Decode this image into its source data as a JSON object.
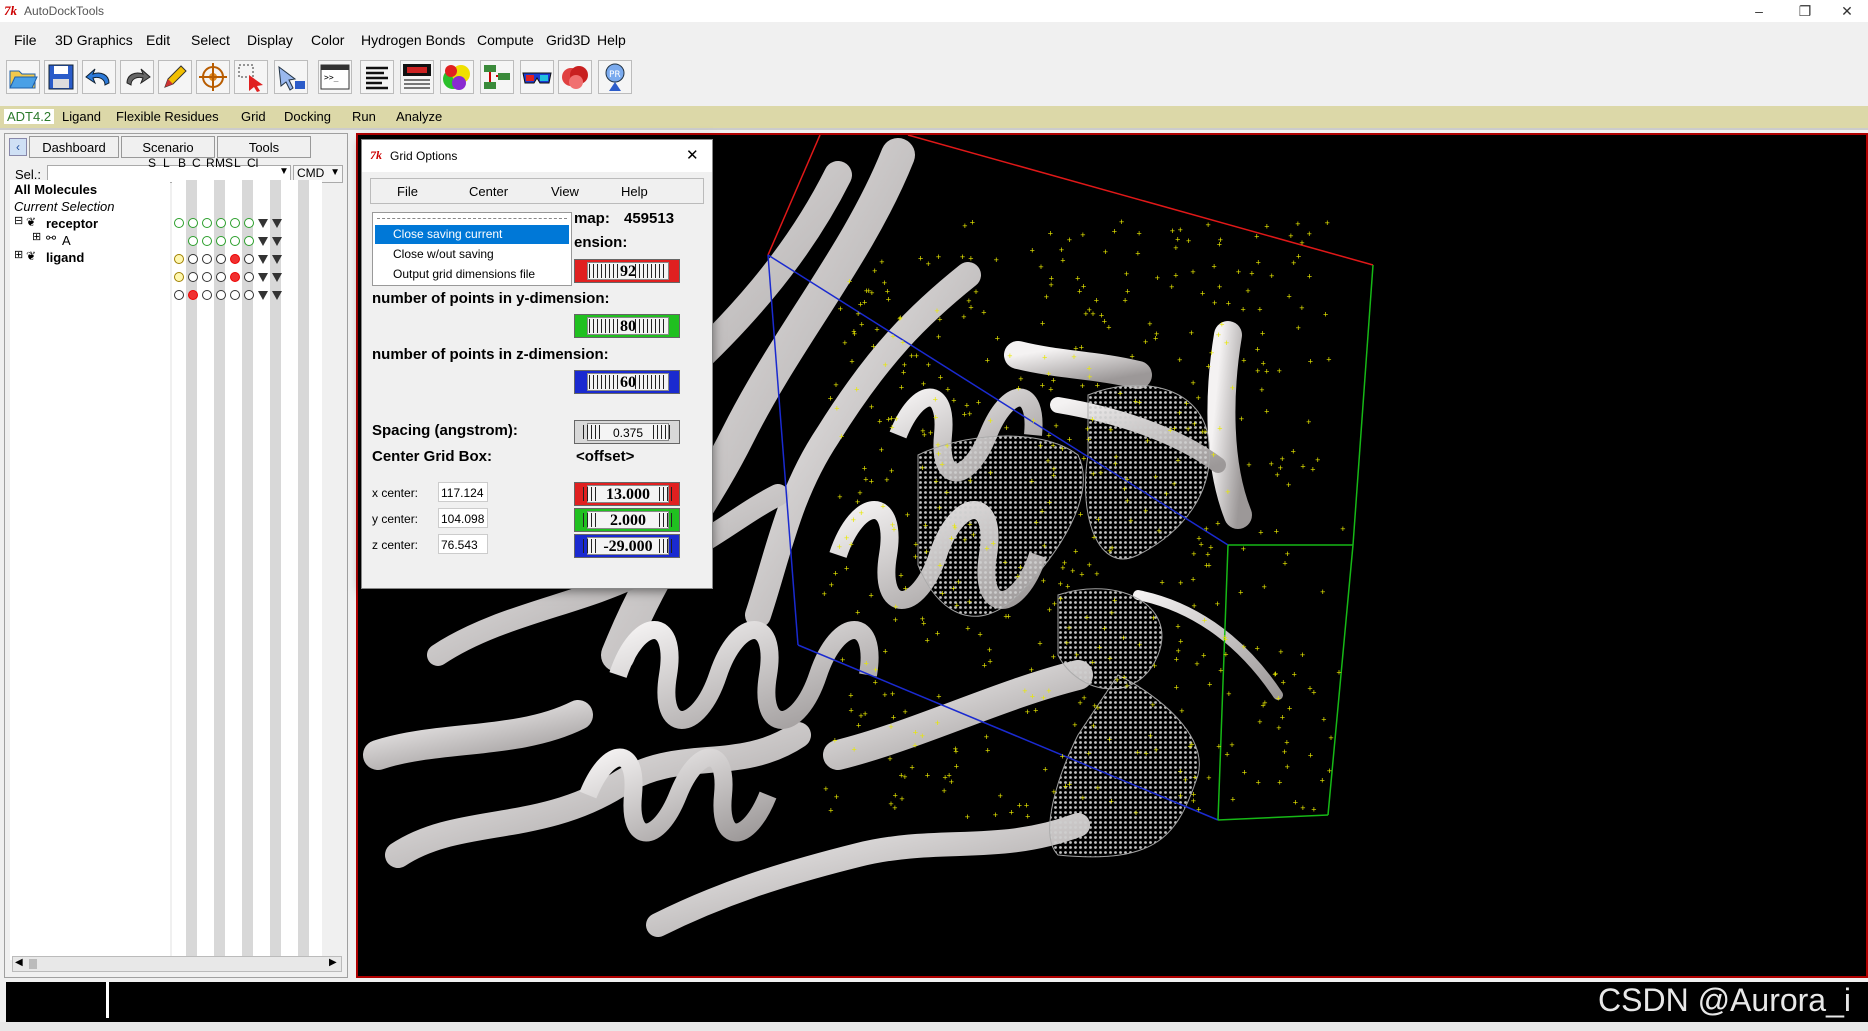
{
  "window": {
    "title": "AutoDockTools",
    "logo": "7k",
    "controls": [
      "–",
      "❐",
      "✕"
    ]
  },
  "menubar": [
    "File",
    "3D Graphics",
    "Edit",
    "Select",
    "Display",
    "Color",
    "Hydrogen Bonds",
    "Compute",
    "Grid3D",
    "Help"
  ],
  "toolbar_icons": [
    "open-folder-icon",
    "save-disk-icon",
    "undo-icon",
    "redo-icon",
    "pencil-icon",
    "center-target-icon",
    "select-icon",
    "pick-icon",
    "python-shell-icon",
    "lines-icon",
    "sequence-viewer-icon",
    "color-sphere-icon",
    "network-icon",
    "stereo-glasses-icon",
    "surface-icon",
    "info-icon"
  ],
  "adt_tabs": [
    "ADT4.2",
    "Ligand",
    "Flexible Residues",
    "Grid",
    "Docking",
    "Run",
    "Analyze"
  ],
  "dashboard": {
    "tabs": [
      "Dashboard",
      "Scenario",
      "Tools"
    ],
    "sel_label": "Sel.:",
    "cmd_label": "CMD",
    "column_headers": [
      "S",
      "L",
      "B",
      "C",
      "R",
      "MS",
      "L",
      "Cl"
    ],
    "tree": [
      "All Molecules",
      "Current Selection",
      "receptor",
      "A",
      "ligand"
    ],
    "tree_expanders": [
      "⊟",
      "⊞",
      "⊞"
    ]
  },
  "grid_dialog": {
    "title": "Grid Options",
    "menus": [
      "File",
      "Center",
      "View",
      "Help"
    ],
    "map_label": "map:",
    "map_value": "459513",
    "x_dim_label": "ension:",
    "x_points": "92",
    "y_dim_label": "number of points in y-dimension:",
    "y_points": "80",
    "z_dim_label": "number of points in z-dimension:",
    "z_points": "60",
    "spacing_label": "Spacing (angstrom):",
    "spacing_value": "0.375",
    "center_label": "Center Grid Box:",
    "offset_label": "<offset>",
    "x_center_label": "x center:",
    "x_center_value": "117.124",
    "x_offset": "13.000",
    "y_center_label": "y center:",
    "y_center_value": "104.098",
    "y_offset": "2.000",
    "z_center_label": "z center:",
    "z_center_value": "76.543",
    "z_offset": "-29.000",
    "close_icon": "✕"
  },
  "file_dropdown": {
    "items": [
      "Close saving current",
      "Close w/out saving",
      "Output grid dimensions file"
    ],
    "selected": "Close saving current"
  },
  "watermark": "CSDN @Aurora_i",
  "colors": {
    "x_axis": "#e01818",
    "y_axis": "#16b816",
    "z_axis": "#1a2ad0",
    "selected": "#0078d7",
    "tab_row": "#dcd8a8",
    "ligand_dots": "#e8e800"
  }
}
